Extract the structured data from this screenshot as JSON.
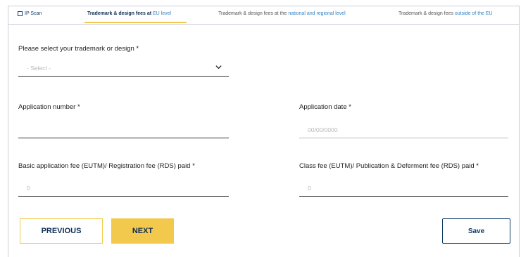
{
  "tabs": {
    "ip_scan": "IP Scan",
    "eu_prefix": "Trademark & design fees at ",
    "eu_highlight": "EU level",
    "national_prefix": "Trademark & design fees at the ",
    "national_highlight": "national and regional level",
    "outside_prefix": "Trademark & design fees ",
    "outside_highlight": "outside of the EU"
  },
  "form": {
    "select_label": "Please select your trademark or design *",
    "select_placeholder": "- Select -",
    "application_number_label": "Application number *",
    "application_number_value": "",
    "application_date_label": "Application date *",
    "application_date_placeholder": "00/00/0000",
    "basic_fee_label": "Basic application fee (EUTM)/ Registration fee (RDS) paid *",
    "basic_fee_placeholder": "0",
    "class_fee_label": "Class fee (EUTM)/ Publication & Deferment fee (RDS) paid *",
    "class_fee_placeholder": "0"
  },
  "buttons": {
    "previous": "PREVIOUS",
    "next": "NEXT",
    "save": "Save"
  },
  "colors": {
    "accent_yellow": "#f2c94c",
    "navy": "#0d2b55",
    "link_blue": "#2f7fc1"
  }
}
